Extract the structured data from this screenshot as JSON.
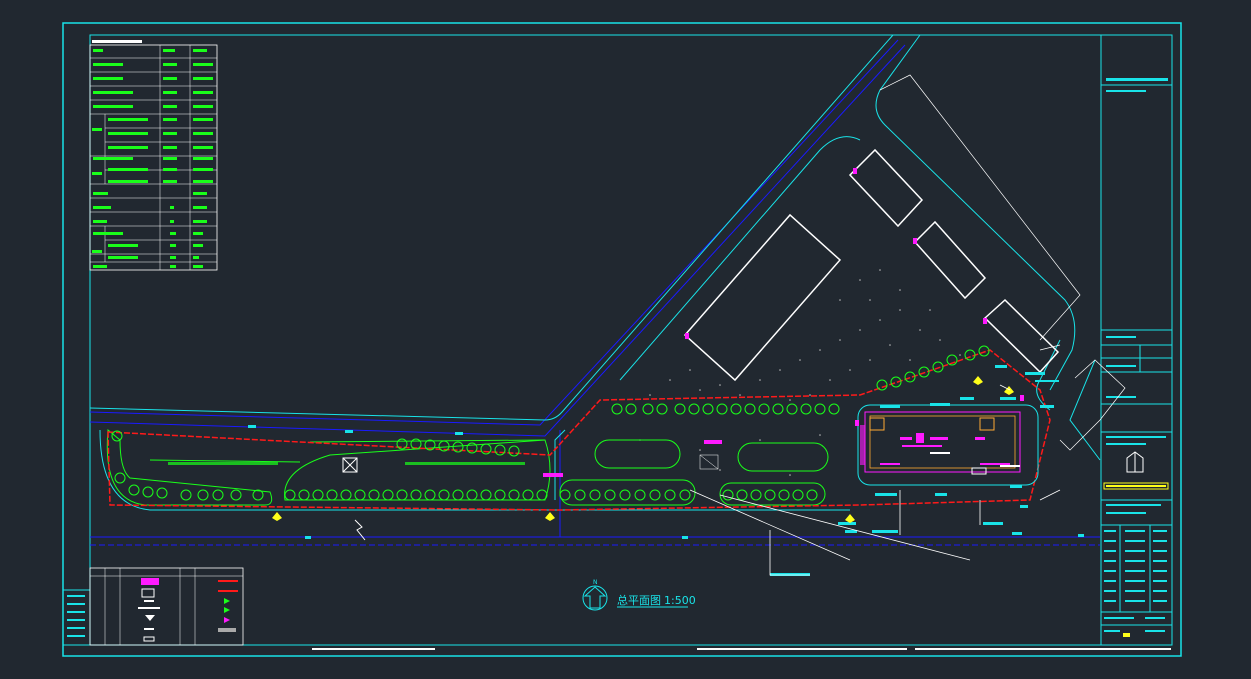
{
  "drawing": {
    "title": "总平面图",
    "scale": "1:500",
    "north_label": "N"
  },
  "colors": {
    "background": "#212830",
    "frame": "#19e3e8",
    "road_line": "#1a1aff",
    "redline": "#ff1a1a",
    "green": "#1aff1a",
    "magenta": "#ff1aff",
    "yellow": "#ffff1a",
    "white": "#ffffff"
  },
  "icons": [
    "north-arrow-icon",
    "tree-symbol-icon",
    "entrance-marker-icon",
    "lightning-break-icon"
  ]
}
